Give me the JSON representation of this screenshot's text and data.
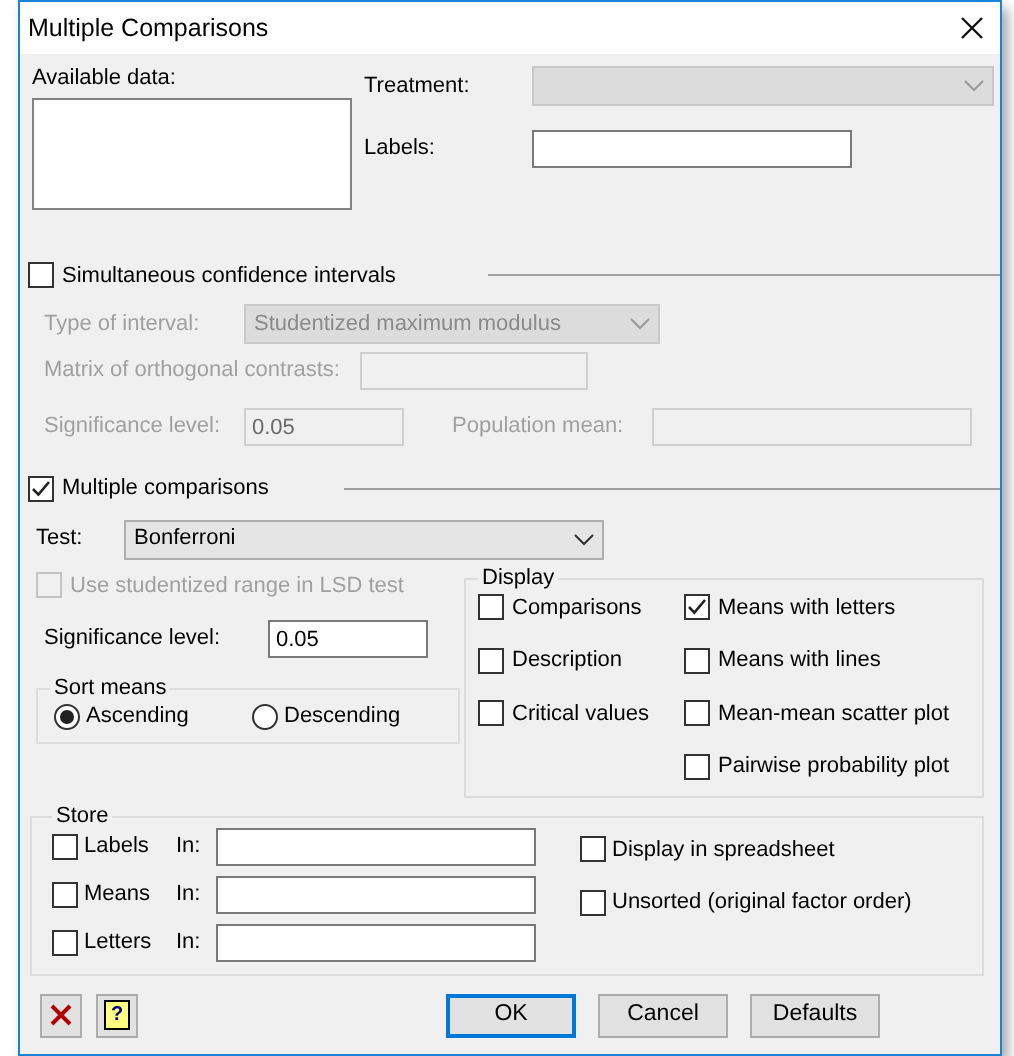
{
  "window": {
    "title": "Multiple Comparisons"
  },
  "available_data": {
    "label": "Available data:"
  },
  "treatment": {
    "label": "Treatment:",
    "disabled": true
  },
  "labels_field": {
    "label": "Labels:"
  },
  "simultaneous": {
    "label": "Simultaneous confidence intervals",
    "checked": false
  },
  "type_of_interval": {
    "label": "Type of interval:",
    "value": "Studentized maximum modulus",
    "disabled": true
  },
  "matrix": {
    "label": "Matrix of orthogonal contrasts:",
    "disabled": true
  },
  "sim_significance": {
    "label": "Significance level:",
    "value": "0.05",
    "disabled": true
  },
  "population_mean": {
    "label": "Population mean:",
    "disabled": true
  },
  "multiple": {
    "label": "Multiple comparisons",
    "checked": true
  },
  "test": {
    "label": "Test:",
    "value": "Bonferroni"
  },
  "studentized": {
    "label": "Use studentized range in LSD test",
    "checked": false,
    "disabled": true
  },
  "significance": {
    "label": "Significance level:",
    "value": "0.05"
  },
  "sort_means": {
    "title": "Sort means",
    "options": [
      {
        "label": "Ascending",
        "selected": true
      },
      {
        "label": "Descending",
        "selected": false
      }
    ]
  },
  "display": {
    "title": "Display",
    "columns": [
      [
        {
          "label": "Comparisons",
          "checked": false
        },
        {
          "label": "Description",
          "checked": false
        },
        {
          "label": "Critical values",
          "checked": false
        }
      ],
      [
        {
          "label": "Means with letters",
          "checked": true
        },
        {
          "label": "Means with lines",
          "checked": false
        },
        {
          "label": "Mean-mean scatter plot",
          "checked": false
        },
        {
          "label": "Pairwise probability plot",
          "checked": false
        }
      ]
    ]
  },
  "store": {
    "title": "Store",
    "items": [
      {
        "label": "Labels",
        "checked": false,
        "in_label": "In:"
      },
      {
        "label": "Means",
        "checked": false,
        "in_label": "In:"
      },
      {
        "label": "Letters",
        "checked": false,
        "in_label": "In:"
      }
    ],
    "options": [
      {
        "label": "Display in spreadsheet",
        "checked": false
      },
      {
        "label": "Unsorted (original factor order)",
        "checked": false
      }
    ]
  },
  "help_button": {
    "text": "?"
  },
  "buttons": [
    {
      "label": "OK",
      "default": true
    },
    {
      "label": "Cancel",
      "default": false
    },
    {
      "label": "Defaults",
      "default": false
    }
  ]
}
